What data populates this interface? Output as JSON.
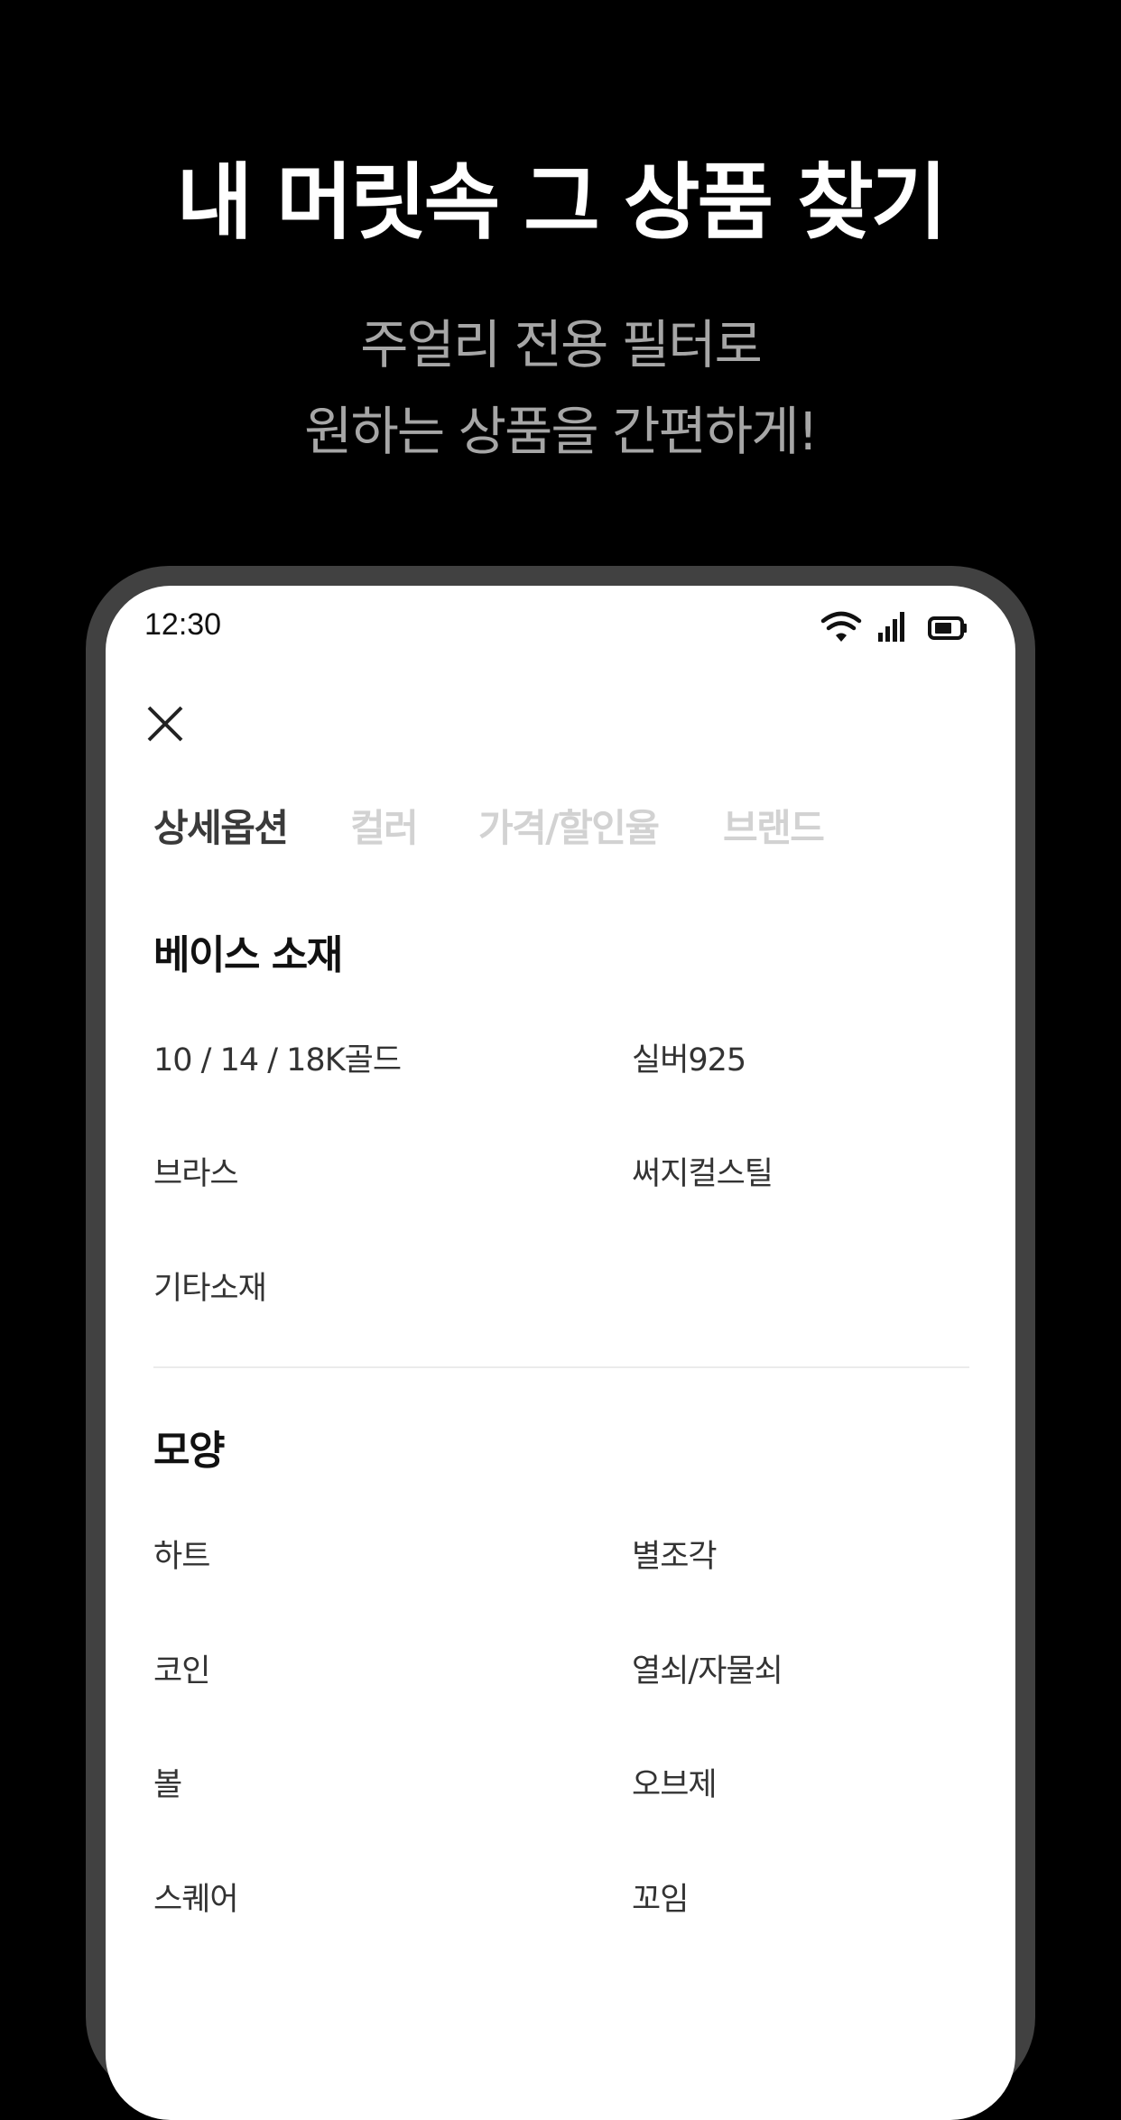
{
  "promo": {
    "title": "내 머릿속 그 상품 찾기",
    "subtitle_line1": "주얼리 전용 필터로",
    "subtitle_line2": "원하는 상품을 간편하게!"
  },
  "status_bar": {
    "time": "12:30",
    "icons": [
      "wifi-icon",
      "signal-icon",
      "battery-icon"
    ]
  },
  "filter": {
    "close_icon": "close-icon",
    "tabs": [
      {
        "label": "상세옵션",
        "active": true
      },
      {
        "label": "컬러",
        "active": false
      },
      {
        "label": "가격/할인율",
        "active": false
      },
      {
        "label": "브랜드",
        "active": false
      }
    ],
    "sections": [
      {
        "title": "베이스 소재",
        "options": [
          "10 / 14 / 18K골드",
          "실버925",
          "브라스",
          "써지컬스틸",
          "기타소재"
        ]
      },
      {
        "title": "모양",
        "options": [
          "하트",
          "별조각",
          "코인",
          "열쇠/자물쇠",
          "볼",
          "오브제",
          "스퀘어",
          "꼬임"
        ]
      }
    ]
  },
  "colors": {
    "background": "#000000",
    "frame": "#414141",
    "title": "#ffffff",
    "subtitle": "#a6a6a6",
    "tab_active": "#3a3a3a",
    "tab_inactive": "#d2d2d2"
  }
}
